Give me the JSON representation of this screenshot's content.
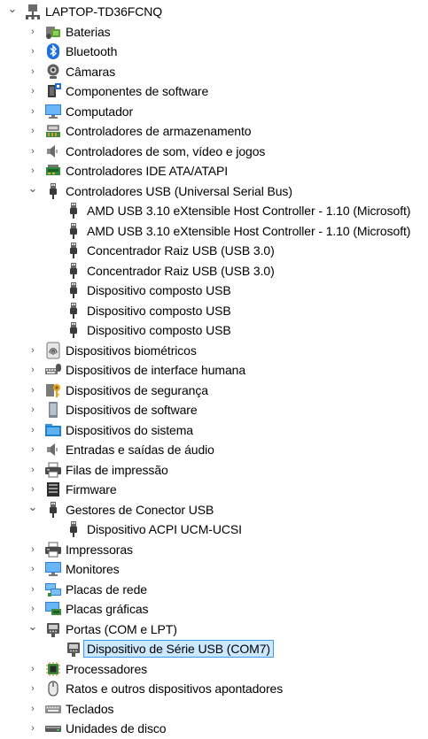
{
  "root": {
    "label": "LAPTOP-TD36FCNQ",
    "expanded": true,
    "icon": "computer-root-icon"
  },
  "categories": [
    {
      "label": "Baterias",
      "icon": "battery-icon",
      "expanded": false,
      "children": []
    },
    {
      "label": "Bluetooth",
      "icon": "bluetooth-icon",
      "expanded": false,
      "children": []
    },
    {
      "label": "Câmaras",
      "icon": "camera-icon",
      "expanded": false,
      "children": []
    },
    {
      "label": "Componentes de software",
      "icon": "software-component-icon",
      "expanded": false,
      "children": []
    },
    {
      "label": "Computador",
      "icon": "monitor-icon",
      "expanded": false,
      "children": []
    },
    {
      "label": "Controladores de armazenamento",
      "icon": "storage-controller-icon",
      "expanded": false,
      "children": []
    },
    {
      "label": "Controladores de som, vídeo e jogos",
      "icon": "speaker-icon",
      "expanded": false,
      "children": []
    },
    {
      "label": "Controladores IDE ATA/ATAPI",
      "icon": "ide-controller-icon",
      "expanded": false,
      "children": []
    },
    {
      "label": "Controladores USB (Universal Serial Bus)",
      "icon": "usb-plug-icon",
      "expanded": true,
      "children": [
        {
          "label": "AMD USB 3.10 eXtensible Host Controller - 1.10 (Microsoft)",
          "icon": "usb-plug-icon"
        },
        {
          "label": "AMD USB 3.10 eXtensible Host Controller - 1.10 (Microsoft)",
          "icon": "usb-plug-icon"
        },
        {
          "label": "Concentrador Raiz USB (USB 3.0)",
          "icon": "usb-plug-icon"
        },
        {
          "label": "Concentrador Raiz USB (USB 3.0)",
          "icon": "usb-plug-icon"
        },
        {
          "label": "Dispositivo composto USB",
          "icon": "usb-plug-icon"
        },
        {
          "label": "Dispositivo composto USB",
          "icon": "usb-plug-icon"
        },
        {
          "label": "Dispositivo composto USB",
          "icon": "usb-plug-icon"
        }
      ]
    },
    {
      "label": "Dispositivos biométricos",
      "icon": "fingerprint-icon",
      "expanded": false,
      "children": []
    },
    {
      "label": "Dispositivos de interface humana",
      "icon": "keyboard-mouse-icon",
      "expanded": false,
      "children": []
    },
    {
      "label": "Dispositivos de segurança",
      "icon": "key-icon",
      "expanded": false,
      "children": []
    },
    {
      "label": "Dispositivos de software",
      "icon": "device-icon",
      "expanded": false,
      "children": []
    },
    {
      "label": "Dispositivos do sistema",
      "icon": "system-folder-icon",
      "expanded": false,
      "children": []
    },
    {
      "label": "Entradas e saídas de áudio",
      "icon": "speaker-icon",
      "expanded": false,
      "children": []
    },
    {
      "label": "Filas de impressão",
      "icon": "printer-icon",
      "expanded": false,
      "children": []
    },
    {
      "label": "Firmware",
      "icon": "firmware-icon",
      "expanded": false,
      "children": []
    },
    {
      "label": "Gestores de Conector USB",
      "icon": "usb-plug-icon",
      "expanded": true,
      "children": [
        {
          "label": "Dispositivo ACPI UCM-UCSI",
          "icon": "usb-plug-icon"
        }
      ]
    },
    {
      "label": "Impressoras",
      "icon": "printer-icon",
      "expanded": false,
      "children": []
    },
    {
      "label": "Monitores",
      "icon": "monitor-icon",
      "expanded": false,
      "children": []
    },
    {
      "label": "Placas de rede",
      "icon": "network-icon",
      "expanded": false,
      "children": []
    },
    {
      "label": "Placas gráficas",
      "icon": "display-adapter-icon",
      "expanded": false,
      "children": []
    },
    {
      "label": "Portas (COM e LPT)",
      "icon": "port-icon",
      "expanded": true,
      "children": [
        {
          "label": "Dispositivo de Série USB (COM7)",
          "icon": "port-icon",
          "selected": true
        }
      ]
    },
    {
      "label": "Processadores",
      "icon": "processor-icon",
      "expanded": false,
      "children": []
    },
    {
      "label": "Ratos e outros dispositivos apontadores",
      "icon": "mouse-icon",
      "expanded": false,
      "children": []
    },
    {
      "label": "Teclados",
      "icon": "keyboard-icon",
      "expanded": false,
      "children": []
    },
    {
      "label": "Unidades de disco",
      "icon": "disk-drive-icon",
      "expanded": false,
      "children": []
    }
  ],
  "colors": {
    "selection_bg": "#cce8ff",
    "selection_border": "#3e9af0",
    "chevron": "#555555"
  }
}
